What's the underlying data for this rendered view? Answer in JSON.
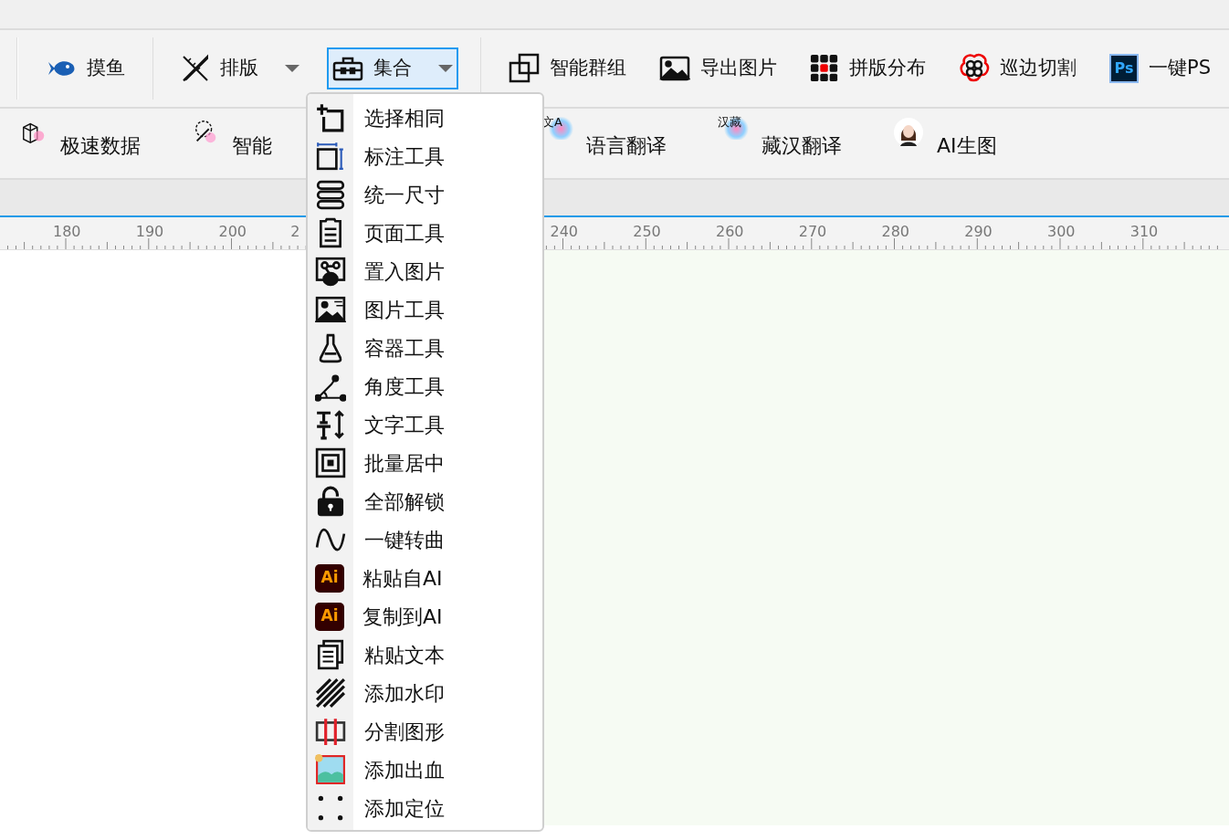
{
  "toolbar": {
    "items": [
      {
        "label": "摸鱼",
        "kind": "button",
        "selected": false
      },
      {
        "label": "排版",
        "kind": "dropdown",
        "selected": false
      },
      {
        "label": "集合",
        "kind": "dropdown",
        "selected": true
      },
      {
        "label": "智能群组",
        "kind": "button",
        "selected": false
      },
      {
        "label": "导出图片",
        "kind": "button",
        "selected": false
      },
      {
        "label": "拼版分布",
        "kind": "button",
        "selected": false
      },
      {
        "label": "巡边切割",
        "kind": "button",
        "selected": false
      },
      {
        "label": "一键PS",
        "kind": "button",
        "selected": false,
        "icon_text": "Ps"
      }
    ]
  },
  "toolbar_2": {
    "items": [
      {
        "label": "极速数据"
      },
      {
        "label": "智能"
      },
      {
        "label": "语言翻译",
        "icon_text": "文A"
      },
      {
        "label": "藏汉翻译",
        "icon_text": "汉藏"
      },
      {
        "label": "AI生图"
      }
    ]
  },
  "ruler": {
    "labels": [
      "180",
      "190",
      "200",
      "2",
      "240",
      "250",
      "260",
      "270",
      "280",
      "290",
      "300",
      "310"
    ]
  },
  "dropdown_menu": {
    "items": [
      {
        "label": "选择相同"
      },
      {
        "label": "标注工具"
      },
      {
        "label": "统一尺寸"
      },
      {
        "label": "页面工具"
      },
      {
        "label": "置入图片"
      },
      {
        "label": "图片工具"
      },
      {
        "label": "容器工具"
      },
      {
        "label": "角度工具"
      },
      {
        "label": "文字工具"
      },
      {
        "label": "批量居中"
      },
      {
        "label": "全部解锁"
      },
      {
        "label": "一键转曲"
      },
      {
        "label": "粘贴自AI",
        "icon_text": "Ai"
      },
      {
        "label": "复制到AI",
        "icon_text": "Ai"
      },
      {
        "label": "粘贴文本"
      },
      {
        "label": "添加水印"
      },
      {
        "label": "分割图形"
      },
      {
        "label": "添加出血"
      },
      {
        "label": "添加定位"
      }
    ]
  }
}
